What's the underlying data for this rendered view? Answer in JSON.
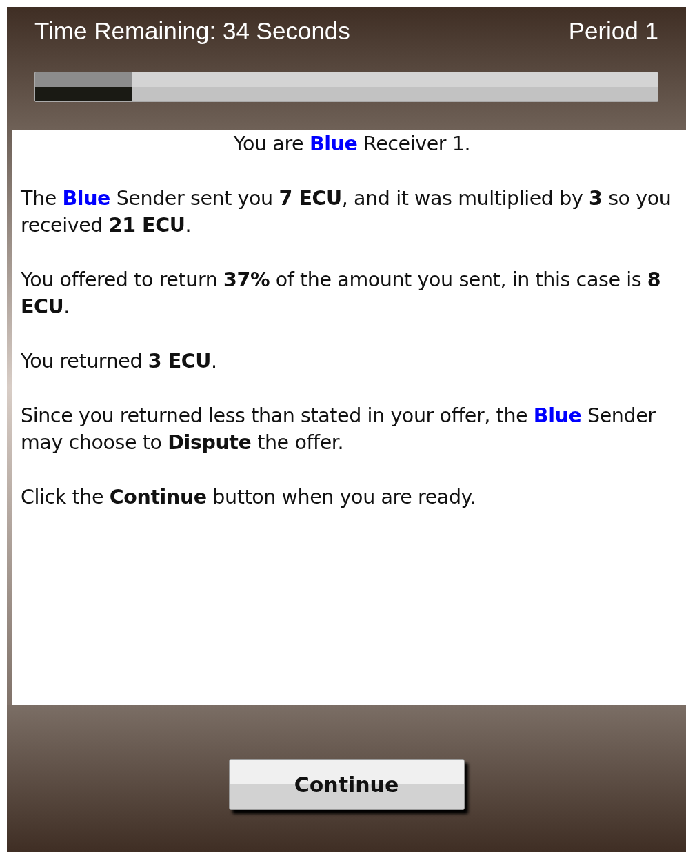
{
  "header": {
    "time_remaining": "Time Remaining: 34 Seconds",
    "period": "Period 1",
    "timer": {
      "level": 0.156
    }
  },
  "greeting": [
    {
      "text": "You are ",
      "kind": "plain"
    },
    {
      "text": "Blue",
      "kind": "team"
    },
    {
      "text": " Receiver 1.",
      "kind": "plain"
    }
  ],
  "paragraphs": [
    [
      {
        "text": "The ",
        "kind": "plain"
      },
      {
        "text": "Blue",
        "kind": "team"
      },
      {
        "text": " Sender sent you ",
        "kind": "plain"
      },
      {
        "text": "7 ECU",
        "kind": "bold"
      },
      {
        "text": ", and it was multiplied by ",
        "kind": "plain"
      },
      {
        "text": "3",
        "kind": "bold"
      },
      {
        "text": " so you received ",
        "kind": "plain"
      },
      {
        "text": "21 ECU",
        "kind": "bold"
      },
      {
        "text": ".",
        "kind": "plain"
      }
    ],
    [
      {
        "text": "You offered to return ",
        "kind": "plain"
      },
      {
        "text": "37%",
        "kind": "bold"
      },
      {
        "text": " of the amount you sent, in this case is ",
        "kind": "plain"
      },
      {
        "text": "8 ECU",
        "kind": "bold"
      },
      {
        "text": ".",
        "kind": "plain"
      }
    ],
    [
      {
        "text": "You returned ",
        "kind": "plain"
      },
      {
        "text": "3 ECU",
        "kind": "bold"
      },
      {
        "text": ".",
        "kind": "plain"
      }
    ],
    [
      {
        "text": "Since you returned less than stated in your offer, the ",
        "kind": "plain"
      },
      {
        "text": "Blue",
        "kind": "team"
      },
      {
        "text": " Sender may choose to ",
        "kind": "plain"
      },
      {
        "text": "Dispute",
        "kind": "bold"
      },
      {
        "text": " the offer.",
        "kind": "plain"
      }
    ],
    [
      {
        "text": "Click the ",
        "kind": "plain"
      },
      {
        "text": "Continue",
        "kind": "bold"
      },
      {
        "text": " button when you are ready.",
        "kind": "plain"
      }
    ]
  ],
  "continue_button": "Continue"
}
